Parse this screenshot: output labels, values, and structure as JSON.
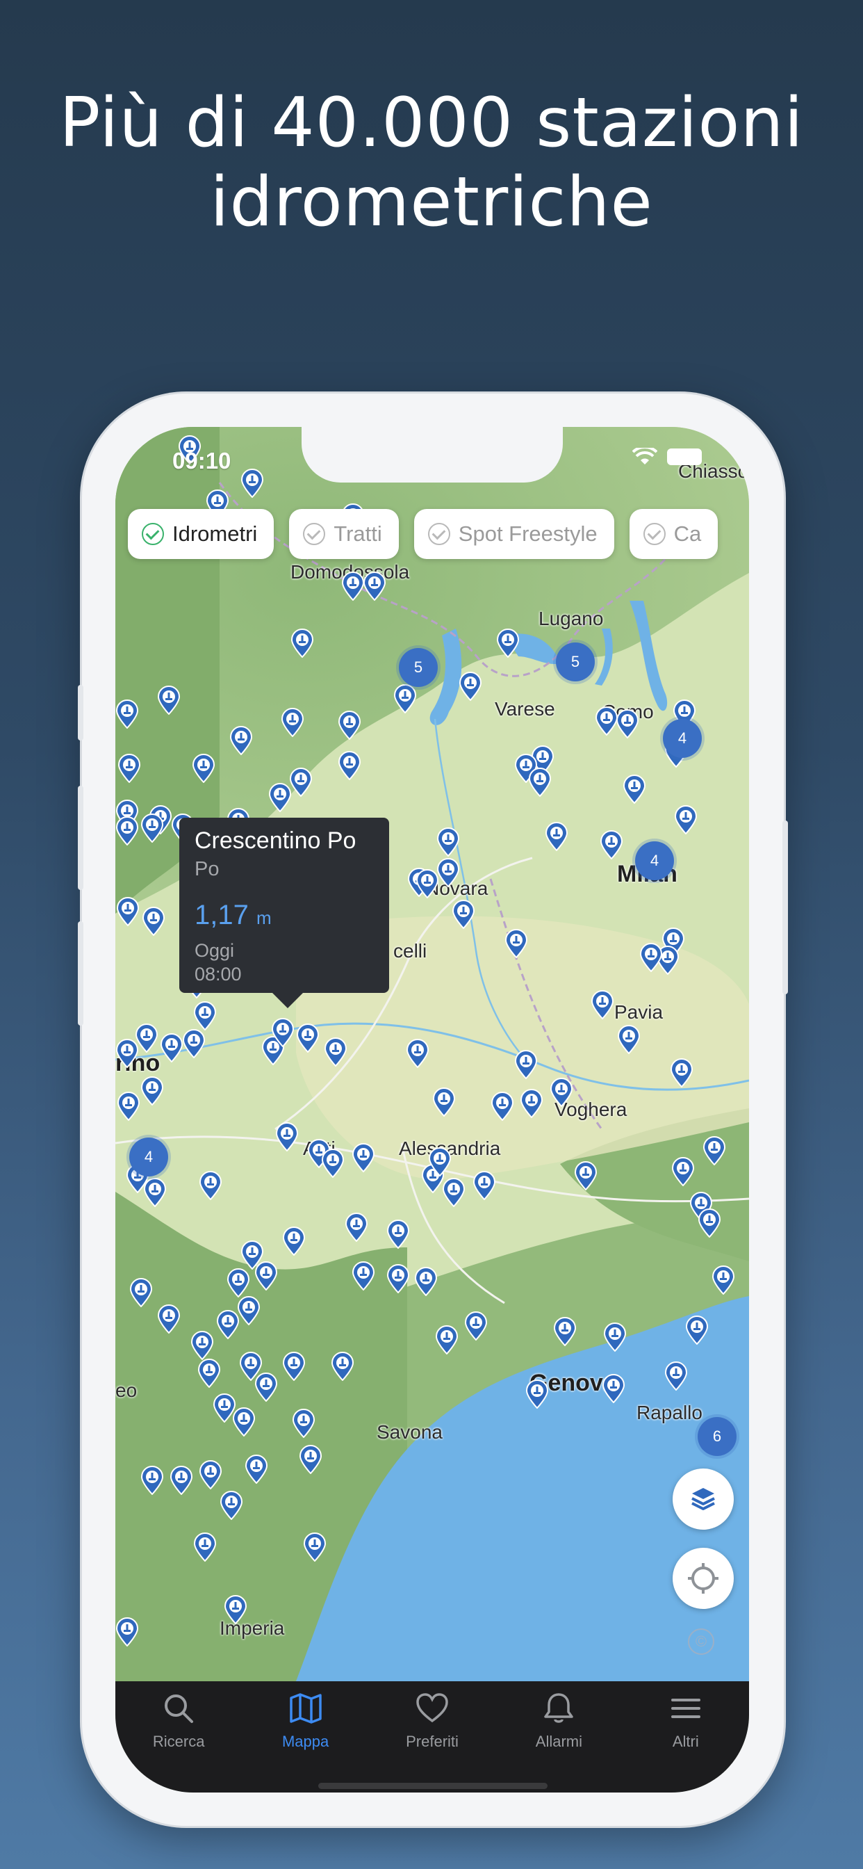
{
  "headline": {
    "line1": "Più di 40.000 stazioni",
    "line2": "idrometriche"
  },
  "status": {
    "time": "09:10"
  },
  "chips": [
    {
      "label": "Idrometri",
      "active": true
    },
    {
      "label": "Tratti",
      "active": false
    },
    {
      "label": "Spot Freestyle",
      "active": false
    },
    {
      "label": "Ca",
      "active": false
    }
  ],
  "cities": {
    "domodossola": "Domodossola",
    "lugano": "Lugano",
    "varese": "Varese",
    "como": "Como",
    "novara": "Novara",
    "milan": "Milan",
    "vercelli": "celli",
    "pavia": "Pavia",
    "torino": "rino",
    "voghera": "Voghera",
    "asti": "Asti",
    "alessandria": "Alessandria",
    "genova": "Genova",
    "rapallo": "Rapallo",
    "savona": "Savona",
    "imperia": "Imperia",
    "chiasso": "Chiasso",
    "cuneo": "eo"
  },
  "clusters": [
    "5",
    "5",
    "4",
    "4",
    "4",
    "6"
  ],
  "popup": {
    "station": "Crescentino Po",
    "river": "Po",
    "value": "1,17",
    "unit": "m",
    "day": "Oggi",
    "time": "08:00"
  },
  "tabs": [
    {
      "label": "Ricerca",
      "icon": "search-icon"
    },
    {
      "label": "Mappa",
      "icon": "map-icon",
      "active": true
    },
    {
      "label": "Preferiti",
      "icon": "heart-icon"
    },
    {
      "label": "Allarmi",
      "icon": "bell-icon"
    },
    {
      "label": "Altri",
      "icon": "menu-icon"
    }
  ],
  "colors": {
    "accent": "#3d8bf2",
    "pin": "#2f68bd",
    "sea": "#6fb2e6",
    "tabbar": "#1c1c1e"
  }
}
